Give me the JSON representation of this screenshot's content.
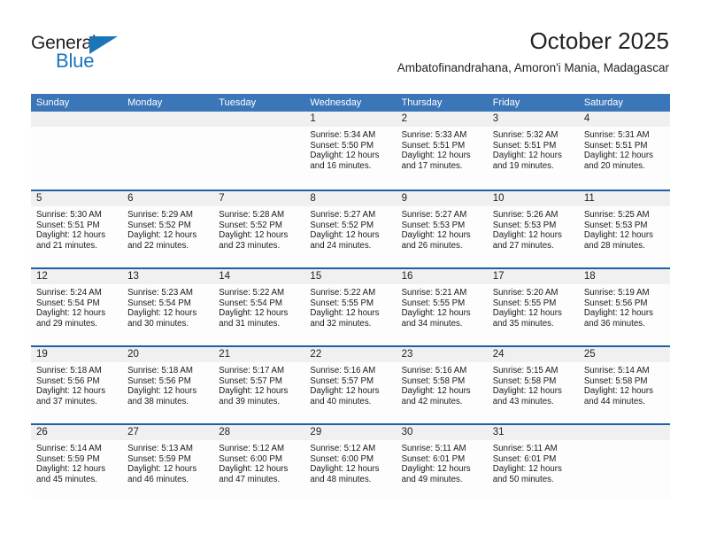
{
  "brand": {
    "name_top": "General",
    "name_bottom": "Blue",
    "triangle_icon": "triangle-icon",
    "accent_color": "#1b75bb"
  },
  "header": {
    "title": "October 2025",
    "subtitle": "Ambatofinandrahana, Amoron'i Mania, Madagascar"
  },
  "theme": {
    "header_band": "#3b77b8",
    "week_rule": "#1f5fa4",
    "daynum_band": "#f0f0f0"
  },
  "weekdays": [
    "Sunday",
    "Monday",
    "Tuesday",
    "Wednesday",
    "Thursday",
    "Friday",
    "Saturday"
  ],
  "labels": {
    "sunrise": "Sunrise:",
    "sunset": "Sunset:",
    "daylight": "Daylight:"
  },
  "weeks": [
    [
      {
        "day": "",
        "empty": true
      },
      {
        "day": "",
        "empty": true
      },
      {
        "day": "",
        "empty": true
      },
      {
        "day": "1",
        "sunrise": "Sunrise: 5:34 AM",
        "sunset": "Sunset: 5:50 PM",
        "daylight": "Daylight: 12 hours and 16 minutes."
      },
      {
        "day": "2",
        "sunrise": "Sunrise: 5:33 AM",
        "sunset": "Sunset: 5:51 PM",
        "daylight": "Daylight: 12 hours and 17 minutes."
      },
      {
        "day": "3",
        "sunrise": "Sunrise: 5:32 AM",
        "sunset": "Sunset: 5:51 PM",
        "daylight": "Daylight: 12 hours and 19 minutes."
      },
      {
        "day": "4",
        "sunrise": "Sunrise: 5:31 AM",
        "sunset": "Sunset: 5:51 PM",
        "daylight": "Daylight: 12 hours and 20 minutes."
      }
    ],
    [
      {
        "day": "5",
        "sunrise": "Sunrise: 5:30 AM",
        "sunset": "Sunset: 5:51 PM",
        "daylight": "Daylight: 12 hours and 21 minutes."
      },
      {
        "day": "6",
        "sunrise": "Sunrise: 5:29 AM",
        "sunset": "Sunset: 5:52 PM",
        "daylight": "Daylight: 12 hours and 22 minutes."
      },
      {
        "day": "7",
        "sunrise": "Sunrise: 5:28 AM",
        "sunset": "Sunset: 5:52 PM",
        "daylight": "Daylight: 12 hours and 23 minutes."
      },
      {
        "day": "8",
        "sunrise": "Sunrise: 5:27 AM",
        "sunset": "Sunset: 5:52 PM",
        "daylight": "Daylight: 12 hours and 24 minutes."
      },
      {
        "day": "9",
        "sunrise": "Sunrise: 5:27 AM",
        "sunset": "Sunset: 5:53 PM",
        "daylight": "Daylight: 12 hours and 26 minutes."
      },
      {
        "day": "10",
        "sunrise": "Sunrise: 5:26 AM",
        "sunset": "Sunset: 5:53 PM",
        "daylight": "Daylight: 12 hours and 27 minutes."
      },
      {
        "day": "11",
        "sunrise": "Sunrise: 5:25 AM",
        "sunset": "Sunset: 5:53 PM",
        "daylight": "Daylight: 12 hours and 28 minutes."
      }
    ],
    [
      {
        "day": "12",
        "sunrise": "Sunrise: 5:24 AM",
        "sunset": "Sunset: 5:54 PM",
        "daylight": "Daylight: 12 hours and 29 minutes."
      },
      {
        "day": "13",
        "sunrise": "Sunrise: 5:23 AM",
        "sunset": "Sunset: 5:54 PM",
        "daylight": "Daylight: 12 hours and 30 minutes."
      },
      {
        "day": "14",
        "sunrise": "Sunrise: 5:22 AM",
        "sunset": "Sunset: 5:54 PM",
        "daylight": "Daylight: 12 hours and 31 minutes."
      },
      {
        "day": "15",
        "sunrise": "Sunrise: 5:22 AM",
        "sunset": "Sunset: 5:55 PM",
        "daylight": "Daylight: 12 hours and 32 minutes."
      },
      {
        "day": "16",
        "sunrise": "Sunrise: 5:21 AM",
        "sunset": "Sunset: 5:55 PM",
        "daylight": "Daylight: 12 hours and 34 minutes."
      },
      {
        "day": "17",
        "sunrise": "Sunrise: 5:20 AM",
        "sunset": "Sunset: 5:55 PM",
        "daylight": "Daylight: 12 hours and 35 minutes."
      },
      {
        "day": "18",
        "sunrise": "Sunrise: 5:19 AM",
        "sunset": "Sunset: 5:56 PM",
        "daylight": "Daylight: 12 hours and 36 minutes."
      }
    ],
    [
      {
        "day": "19",
        "sunrise": "Sunrise: 5:18 AM",
        "sunset": "Sunset: 5:56 PM",
        "daylight": "Daylight: 12 hours and 37 minutes."
      },
      {
        "day": "20",
        "sunrise": "Sunrise: 5:18 AM",
        "sunset": "Sunset: 5:56 PM",
        "daylight": "Daylight: 12 hours and 38 minutes."
      },
      {
        "day": "21",
        "sunrise": "Sunrise: 5:17 AM",
        "sunset": "Sunset: 5:57 PM",
        "daylight": "Daylight: 12 hours and 39 minutes."
      },
      {
        "day": "22",
        "sunrise": "Sunrise: 5:16 AM",
        "sunset": "Sunset: 5:57 PM",
        "daylight": "Daylight: 12 hours and 40 minutes."
      },
      {
        "day": "23",
        "sunrise": "Sunrise: 5:16 AM",
        "sunset": "Sunset: 5:58 PM",
        "daylight": "Daylight: 12 hours and 42 minutes."
      },
      {
        "day": "24",
        "sunrise": "Sunrise: 5:15 AM",
        "sunset": "Sunset: 5:58 PM",
        "daylight": "Daylight: 12 hours and 43 minutes."
      },
      {
        "day": "25",
        "sunrise": "Sunrise: 5:14 AM",
        "sunset": "Sunset: 5:58 PM",
        "daylight": "Daylight: 12 hours and 44 minutes."
      }
    ],
    [
      {
        "day": "26",
        "sunrise": "Sunrise: 5:14 AM",
        "sunset": "Sunset: 5:59 PM",
        "daylight": "Daylight: 12 hours and 45 minutes."
      },
      {
        "day": "27",
        "sunrise": "Sunrise: 5:13 AM",
        "sunset": "Sunset: 5:59 PM",
        "daylight": "Daylight: 12 hours and 46 minutes."
      },
      {
        "day": "28",
        "sunrise": "Sunrise: 5:12 AM",
        "sunset": "Sunset: 6:00 PM",
        "daylight": "Daylight: 12 hours and 47 minutes."
      },
      {
        "day": "29",
        "sunrise": "Sunrise: 5:12 AM",
        "sunset": "Sunset: 6:00 PM",
        "daylight": "Daylight: 12 hours and 48 minutes."
      },
      {
        "day": "30",
        "sunrise": "Sunrise: 5:11 AM",
        "sunset": "Sunset: 6:01 PM",
        "daylight": "Daylight: 12 hours and 49 minutes."
      },
      {
        "day": "31",
        "sunrise": "Sunrise: 5:11 AM",
        "sunset": "Sunset: 6:01 PM",
        "daylight": "Daylight: 12 hours and 50 minutes."
      },
      {
        "day": "",
        "empty": true
      }
    ]
  ]
}
